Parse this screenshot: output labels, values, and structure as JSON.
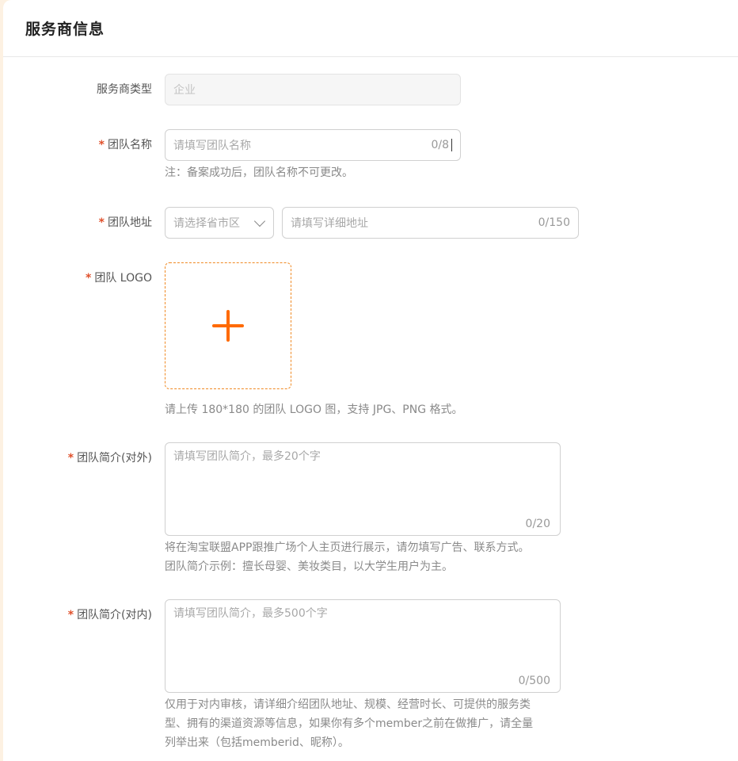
{
  "header": {
    "title": "服务商信息"
  },
  "form": {
    "provider_type": {
      "label": "服务商类型",
      "value": "企业"
    },
    "team_name": {
      "required_mark": "*",
      "label": "团队名称",
      "placeholder": "请填写团队名称",
      "counter": "0/8",
      "hint": "注：备案成功后，团队名称不可更改。"
    },
    "team_address": {
      "required_mark": "*",
      "label": "团队地址",
      "region_placeholder": "请选择省市区",
      "detail_placeholder": "请填写详细地址",
      "counter": "0/150"
    },
    "team_logo": {
      "required_mark": "*",
      "label": "团队 LOGO",
      "hint": "请上传 180*180 的团队 LOGO 图，支持 JPG、PNG 格式。"
    },
    "intro_external": {
      "required_mark": "*",
      "label": "团队简介(对外)",
      "placeholder": "请填写团队简介，最多20个字",
      "counter": "0/20",
      "hint_line1": "将在淘宝联盟APP跟推广场个人主页进行展示，请勿填写广告、联系方式。",
      "hint_line2": "团队简介示例：擅长母婴、美妆类目，以大学生用户为主。"
    },
    "intro_internal": {
      "required_mark": "*",
      "label": "团队简介(对内)",
      "placeholder": "请填写团队简介，最多500个字",
      "counter": "0/500",
      "hint_line1": "仅用于对内审核，请详细介绍团队地址、规模、经营时长、可提供的服务类",
      "hint_line2": "型、拥有的渠道资源等信息，如果你有多个member之前在做推广，请全量",
      "hint_line3": "列举出来（包括memberid、昵称）。"
    }
  },
  "colors": {
    "accent": "#ff6a00",
    "required": "#e0502b",
    "page_bg": "#fdf1e2"
  },
  "icons": {
    "upload": "plus-icon",
    "select": "chevron-down-icon"
  }
}
